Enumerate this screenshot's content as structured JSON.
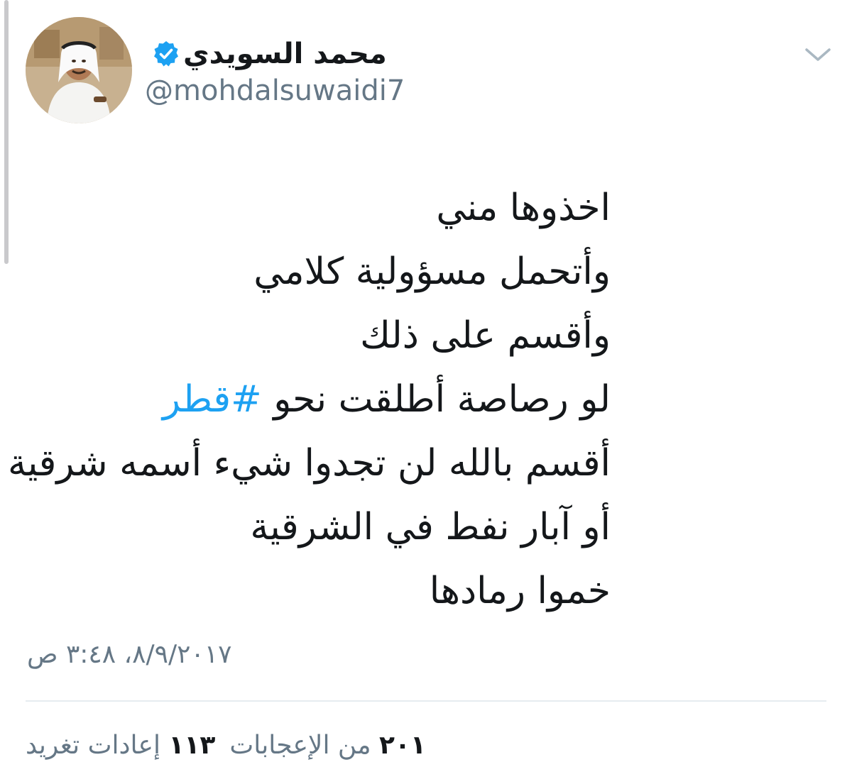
{
  "author": {
    "display_name": "محمد السويدي",
    "handle": "@mohdalsuwaidi7",
    "verified": true
  },
  "tweet": {
    "lines": [
      "اخذوها مني",
      "وأتحمل مسؤولية كلامي",
      "وأقسم على ذلك"
    ],
    "hashtag_line_prefix": "لو رصاصة أطلقت نحو ",
    "hashtag": "#قطر",
    "lines_after": [
      "أقسم بالله لن تجدوا شيء أسمه شرقية",
      "أو آبار نفط في الشرقية",
      "خموا رمادها"
    ]
  },
  "timestamp": "٨/٩/٢٠١٧، ٣:٤٨ ص",
  "stats": {
    "retweets_count": "١١٣",
    "retweets_label": "إعادات تغريد",
    "likes_count": "٢٠١",
    "likes_label": "من الإعجابات"
  },
  "icons": {
    "verified": "verified-badge-icon",
    "chevron": "chevron-down-icon"
  },
  "colors": {
    "hashtag": "#1da1f2",
    "verified": "#1da1f2",
    "secondary_text": "#657786"
  }
}
